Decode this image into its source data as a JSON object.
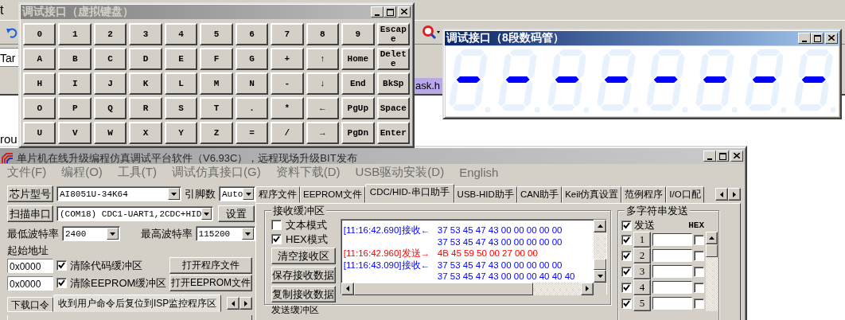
{
  "background_app": {
    "menu_fragment": "t",
    "field_text": "Tar",
    "tab_label": "ask.h",
    "text_fragment": "rou"
  },
  "keypad_window": {
    "title": "调试接口（虚拟键盘）",
    "active": false,
    "keys": [
      [
        "0",
        "1",
        "2",
        "3",
        "4",
        "5",
        "6",
        "7",
        "8",
        "9",
        "Escape"
      ],
      [
        "A",
        "B",
        "C",
        "D",
        "E",
        "F",
        "G",
        "+",
        "↑",
        "Home",
        "Delete"
      ],
      [
        "H",
        "I",
        "J",
        "K",
        "L",
        "M",
        "N",
        "-",
        "↓",
        "End",
        "BkSp"
      ],
      [
        "O",
        "P",
        "Q",
        "R",
        "S",
        "T",
        ".",
        "*",
        "←",
        "PgUp",
        "Space"
      ],
      [
        "U",
        "V",
        "W",
        "X",
        "Y",
        "Z",
        "=",
        "/",
        "→",
        "PgDn",
        "Enter"
      ]
    ]
  },
  "display_window": {
    "title": "调试接口（8段数码管）",
    "active": true,
    "digits": [
      {
        "lit": {
          "a": false,
          "b": false,
          "c": false,
          "d": false,
          "e": false,
          "f": false,
          "g": true,
          "dp": false
        }
      },
      {
        "lit": {
          "a": false,
          "b": false,
          "c": false,
          "d": false,
          "e": false,
          "f": false,
          "g": true,
          "dp": false
        }
      },
      {
        "lit": {
          "a": false,
          "b": false,
          "c": false,
          "d": false,
          "e": false,
          "f": false,
          "g": true,
          "dp": false
        }
      },
      {
        "lit": {
          "a": false,
          "b": false,
          "c": false,
          "d": false,
          "e": false,
          "f": false,
          "g": true,
          "dp": false
        }
      },
      {
        "lit": {
          "a": false,
          "b": false,
          "c": false,
          "d": false,
          "e": false,
          "f": false,
          "g": true,
          "dp": false
        }
      },
      {
        "lit": {
          "a": false,
          "b": false,
          "c": false,
          "d": false,
          "e": false,
          "f": false,
          "g": true,
          "dp": false
        }
      },
      {
        "lit": {
          "a": false,
          "b": false,
          "c": false,
          "d": false,
          "e": false,
          "f": false,
          "g": true,
          "dp": false
        }
      },
      {
        "lit": {
          "a": false,
          "b": false,
          "c": false,
          "d": false,
          "e": false,
          "f": false,
          "g": true,
          "dp": false
        }
      }
    ]
  },
  "main_window": {
    "title": "单片机在线升级编程仿真调试平台软件（V6.93C），远程现场升级BIT发布",
    "active": false,
    "menu": [
      "文件(F)",
      "编程(O)",
      "工具(T)",
      "调试仿真接口(G)",
      "资料下载(D)",
      "USB驱动安装(D)",
      "English"
    ],
    "chip_model": {
      "button": "芯片型号",
      "value": "AI8051U-34K64"
    },
    "pin_count": {
      "label": "引脚数",
      "value": "Auto"
    },
    "port": {
      "button": "扫描串口",
      "value": "(COM18) CDC1-UART1,2CDC+HID",
      "settings_button": "设置"
    },
    "baud_min": {
      "label": "最低波特率",
      "value": "2400"
    },
    "baud_max": {
      "label": "最高波特率",
      "value": "115200"
    },
    "start_address": {
      "label": "起始地址",
      "rows": [
        {
          "value": "0x0000",
          "option": "清除代码缓冲区",
          "checked": true,
          "button": "打开程序文件"
        },
        {
          "value": "0x0000",
          "option": "清除EEPROM缓冲区",
          "checked": true,
          "button": "打开EEPROM文件"
        }
      ]
    },
    "lower_tabs": [
      {
        "label": "下载口令",
        "selected": false
      },
      {
        "label": "收到用户命令后复位到ISP监控程序区",
        "selected": true
      }
    ],
    "tabs": [
      {
        "label": "程序文件",
        "selected": false
      },
      {
        "label": "EEPROM文件",
        "selected": false
      },
      {
        "label": "CDC/HID-串口助手",
        "selected": true
      },
      {
        "label": "USB-HID助手",
        "selected": false
      },
      {
        "label": "CAN助手",
        "selected": false
      },
      {
        "label": "Keil仿真设置",
        "selected": false
      },
      {
        "label": "范例程序",
        "selected": false
      },
      {
        "label": "I/O口配",
        "selected": false
      }
    ],
    "receive_buffer": {
      "title": "接收缓冲区",
      "modes": [
        {
          "label": "文本模式",
          "checked": false
        },
        {
          "label": "HEX模式",
          "checked": true
        }
      ],
      "buttons": [
        "清空接收区",
        "保存接收数据",
        "复制接收数据"
      ],
      "lines": [
        {
          "kind": "receive",
          "stamp": "[11:16:42.690]接收←",
          "data": "37 53 45 47 43 00 00 00 00 00"
        },
        {
          "kind": "receive",
          "data": "37 53 45 47 43 00 00 00 00 00"
        },
        {
          "kind": "send",
          "stamp": "[11:16:42.960]发送→",
          "data": "4B 45 59 50 00 27 00 00"
        },
        {
          "kind": "receive",
          "stamp": "[11:16:43.090]接收←",
          "data": "37 53 45 47 43 00 00 00 00 00"
        },
        {
          "kind": "receive",
          "data": "37 53 45 47 43 00 00 00 40 40 40"
        }
      ]
    },
    "send_buffer": {
      "title": "发送缓冲区"
    },
    "multi_send": {
      "title": "多字符串发送",
      "send_all": {
        "label": "发送",
        "checked": true
      },
      "hex_label": "HEX",
      "rows": [
        {
          "number": "1",
          "checked": true,
          "hex": false
        },
        {
          "number": "2",
          "checked": true,
          "hex": false
        },
        {
          "number": "3",
          "checked": true,
          "hex": false
        },
        {
          "number": "4",
          "checked": true,
          "hex": false
        },
        {
          "number": "5",
          "checked": true,
          "hex": false
        }
      ]
    }
  }
}
